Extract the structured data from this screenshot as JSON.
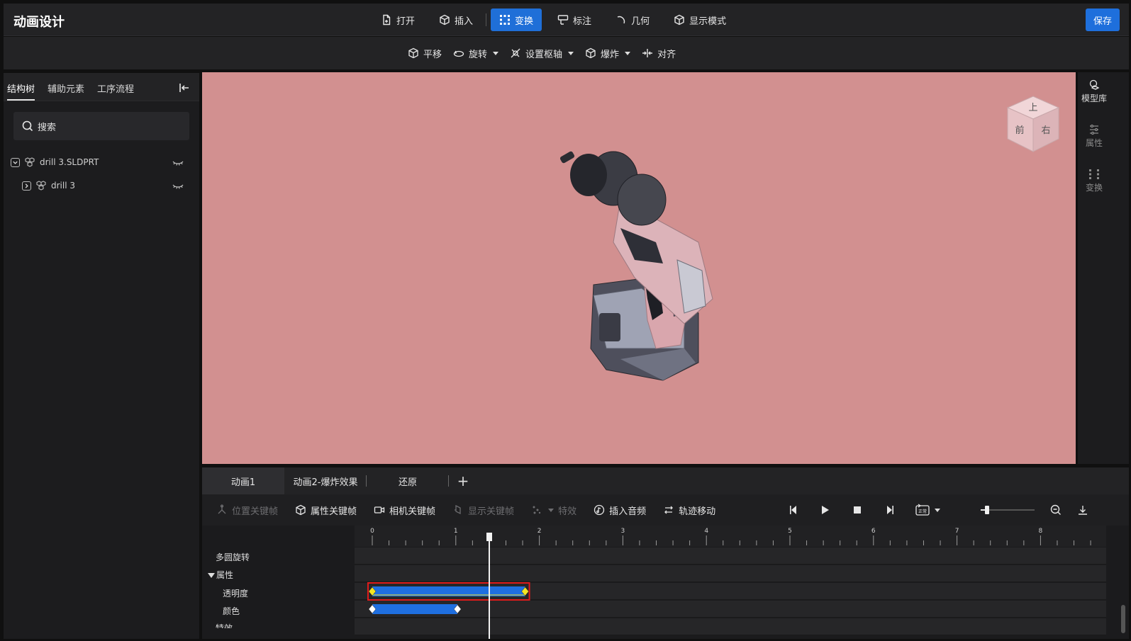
{
  "app": {
    "title": "动画设计",
    "save_label": "保存"
  },
  "main_menu": [
    {
      "label": "打开",
      "icon": "file-plus-icon"
    },
    {
      "label": "插入",
      "icon": "cube-icon"
    },
    {
      "label": "变换",
      "icon": "transform-icon",
      "active": true
    },
    {
      "label": "标注",
      "icon": "annotate-icon"
    },
    {
      "label": "几何",
      "icon": "arc-icon"
    },
    {
      "label": "显示模式",
      "icon": "display-cube-icon"
    }
  ],
  "sub_menu": [
    {
      "label": "平移",
      "icon": "move-cube-icon",
      "dropdown": false
    },
    {
      "label": "旋转",
      "icon": "rotate-icon",
      "dropdown": true
    },
    {
      "label": "设置枢轴",
      "icon": "pivot-icon",
      "dropdown": true
    },
    {
      "label": "爆炸",
      "icon": "explode-icon",
      "dropdown": true
    },
    {
      "label": "对齐",
      "icon": "align-icon",
      "dropdown": false
    }
  ],
  "left_panel": {
    "tabs": [
      "结构树",
      "辅助元素",
      "工序流程"
    ],
    "active_tab": 0,
    "search_placeholder": "搜索",
    "tree": [
      {
        "label": "drill 3.SLDPRT",
        "expanded": true
      },
      {
        "label": "drill 3",
        "expanded": false
      }
    ]
  },
  "view_cube": {
    "top": "上",
    "front": "前",
    "right": "右"
  },
  "right_rail": [
    {
      "label": "模型库",
      "icon": "model-library-icon"
    },
    {
      "label": "属性",
      "icon": "sliders-icon"
    },
    {
      "label": "变换",
      "icon": "transform-grid-icon"
    }
  ],
  "timeline": {
    "tabs": [
      "动画1",
      "动画2-爆炸效果",
      "还原"
    ],
    "active_tab": 0,
    "toolbar": [
      {
        "label": "位置关键帧",
        "icon": "position-keyframe-icon",
        "enabled": false
      },
      {
        "label": "属性关键帧",
        "icon": "property-keyframe-icon",
        "enabled": true
      },
      {
        "label": "相机关键帧",
        "icon": "camera-icon",
        "enabled": true
      },
      {
        "label": "显示关键帧",
        "icon": "display-keyframe-icon",
        "enabled": false
      },
      {
        "label": "特效",
        "icon": "effects-icon",
        "enabled": false
      },
      {
        "label": "插入音频",
        "icon": "audio-icon",
        "enabled": true
      },
      {
        "label": "轨迹移动",
        "icon": "track-move-icon",
        "enabled": true
      }
    ],
    "playback": {
      "speed_badge": "正常",
      "zoom_level": 0.12
    },
    "ruler_labels": [
      "0",
      "1",
      "2",
      "3",
      "4",
      "5",
      "6",
      "7",
      "8"
    ],
    "playhead_time": 1.4,
    "tracks": [
      {
        "label": "多圆旋转",
        "indent": 0
      },
      {
        "label": "属性",
        "indent": 0,
        "group": true
      },
      {
        "label": "透明度",
        "indent": 1
      },
      {
        "label": "颜色",
        "indent": 1
      },
      {
        "label": "特效",
        "indent": 0
      }
    ],
    "clips": [
      {
        "track": "透明度",
        "start": 0.0,
        "end": 1.83,
        "selected": true
      },
      {
        "track": "颜色",
        "start": 0.0,
        "end": 1.02,
        "selected": false
      }
    ],
    "colors": {
      "clip": "#1f6fe0",
      "keyframe_selected": "#f5e623",
      "keyframe": "#ffffff",
      "selection": "#e01b1b"
    }
  }
}
